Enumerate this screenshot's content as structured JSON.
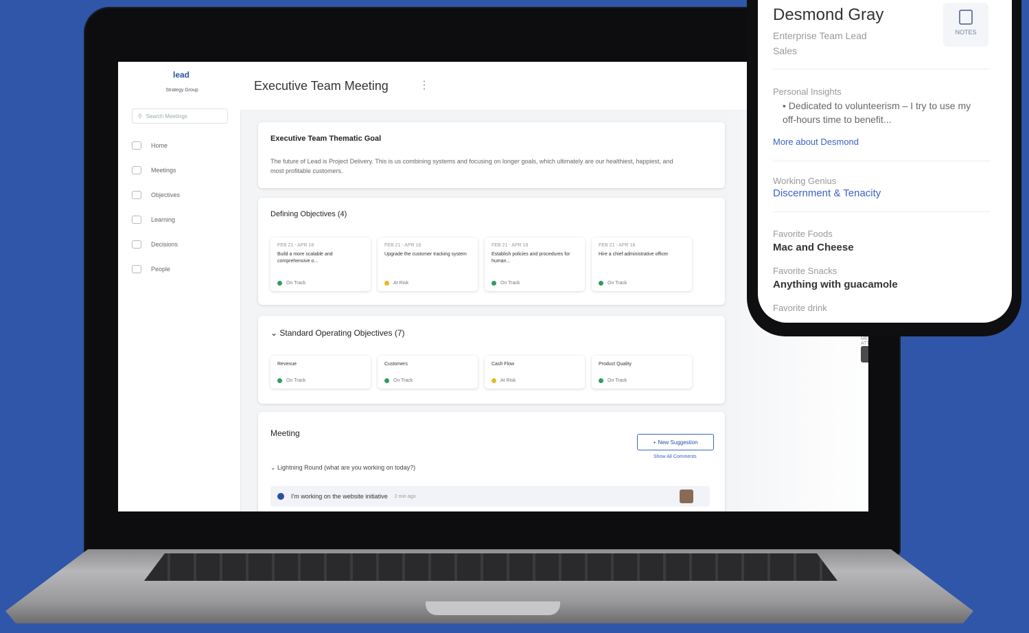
{
  "app": {
    "logo": "lead",
    "logo_sub": "Strategy Group",
    "search_placeholder": "Search Meetings",
    "nav": [
      "Home",
      "Meetings",
      "Objectives",
      "Learning",
      "Decisions",
      "People"
    ]
  },
  "main": {
    "title": "Executive Team Meeting",
    "goal": {
      "title": "Executive Team Thematic Goal",
      "text": "The future of Lead is Project Delivery. This is us combining systems and focusing on longer goals, which ultimately are our healthiest, happiest, and most profitable customers."
    },
    "defining": {
      "title": "Defining Objectives (4)",
      "items": [
        {
          "date": "FEB 21 - APR 18",
          "desc": "Build a more scalable and comprehensive o...",
          "status": "On Track",
          "color": "#2e9e5b"
        },
        {
          "date": "FEB 21 - APR 18",
          "desc": "Upgrade the customer tracking system",
          "status": "At Risk",
          "color": "#e8b923"
        },
        {
          "date": "FEB 21 - APR 18",
          "desc": "Establish policies and procedures for human...",
          "status": "On Track",
          "color": "#2e9e5b"
        },
        {
          "date": "FEB 21 - APR 18",
          "desc": "Hire a chief administrative officer",
          "status": "On Track",
          "color": "#2e9e5b"
        }
      ]
    },
    "sop": {
      "title": "Standard Operating Objectives (7)",
      "items": [
        {
          "desc": "Revenue",
          "status": "On Track",
          "color": "#2e9e5b"
        },
        {
          "desc": "Customers",
          "status": "On Track",
          "color": "#2e9e5b"
        },
        {
          "desc": "Cash Flow",
          "status": "At Risk",
          "color": "#e8b923"
        },
        {
          "desc": "Product Quality",
          "status": "On Track",
          "color": "#2e9e5b"
        }
      ]
    },
    "meeting": {
      "title": "Meeting",
      "new_btn": "+ New Suggestion",
      "show_all": "Show All Comments",
      "section": "Lightning Round (what are you working on today?)",
      "row_text": "I'm working on the website initiative",
      "row_time": "2 min ago"
    },
    "attendees_label": "MEETING ATTENDEES"
  },
  "phone": {
    "name": "Desmond Gray",
    "role": "Enterprise Team Lead",
    "dept": "Sales",
    "notes_label": "NOTES",
    "insights_label": "Personal Insights",
    "insights_text": "Dedicated to volunteerism – I try to use my off-hours time to benefit...",
    "more_link": "More about Desmond",
    "genius_label": "Working Genius",
    "genius_value": "Discernment & Tenacity",
    "food_label": "Favorite Foods",
    "food_value": "Mac and Cheese",
    "snack_label": "Favorite Snacks",
    "snack_value": "Anything with guacamole",
    "drink_label": "Favorite drink"
  },
  "colors": {
    "background": "#2f56a8",
    "accent": "#3b63c4",
    "on_track": "#2e9e5b",
    "at_risk": "#e8b923"
  }
}
